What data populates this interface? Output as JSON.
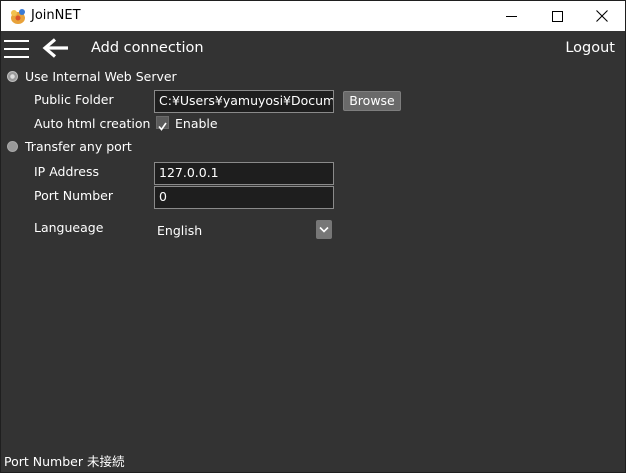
{
  "window": {
    "title": "JoinNET"
  },
  "toolbar": {
    "title": "Add connection",
    "logout_label": "Logout"
  },
  "mode": {
    "internal_server_label": "Use Internal Web Server",
    "internal_server_selected": true,
    "transfer_port_label": "Transfer any port",
    "transfer_port_selected": false
  },
  "internal": {
    "public_folder_label": "Public Folder",
    "public_folder_value": "C:¥Users¥yamuyosi¥Documen",
    "browse_label": "Browse",
    "auto_html_label": "Auto html creation",
    "auto_html_checkbox_label": "Enable",
    "auto_html_checked": true
  },
  "transfer": {
    "ip_label": "IP Address",
    "ip_value": "127.0.0.1",
    "port_label": "Port Number",
    "port_value": "0"
  },
  "language": {
    "label": "Langueage",
    "selected": "English"
  },
  "status": {
    "text": "Port Number 未接続"
  },
  "icons": {
    "app": "joinnet-logo-icon",
    "menu": "hamburger-menu-icon",
    "back": "back-arrow-icon",
    "dropdown": "chevron-down-icon",
    "checkbox": "checkmark-icon"
  },
  "colors": {
    "background": "#333333",
    "titlebar": "#ffffff",
    "input_bg": "#1e1e1e",
    "button_bg": "#6a6a6a",
    "text": "#ffffff"
  }
}
